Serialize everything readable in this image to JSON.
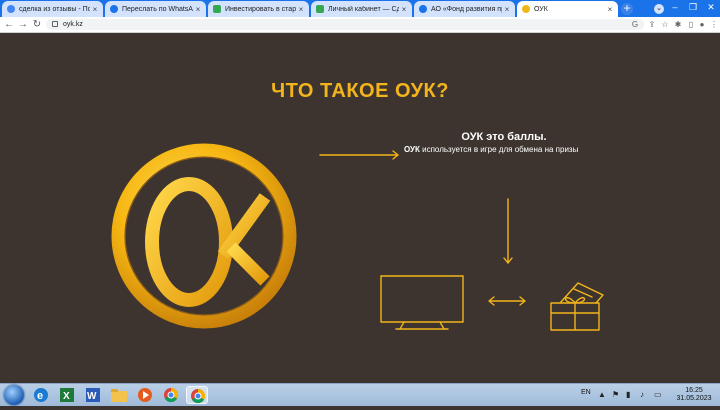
{
  "browser": {
    "tabs": [
      {
        "title": "сделка из отзывы - Поиск в G",
        "favicon_color": "#4285f4"
      },
      {
        "title": "Переслать по WhatsApp",
        "favicon_color": "#1a73e8"
      },
      {
        "title": "Инвестировать в стартап - Сд",
        "favicon_color": "#34a853"
      },
      {
        "title": "Личный кабинет — Сделка",
        "favicon_color": "#34a853"
      },
      {
        "title": "АО «Фонд развития предпри",
        "favicon_color": "#1a73e8"
      },
      {
        "title": "ОУК",
        "favicon_color": "#f3b51c"
      }
    ],
    "new_tab": "+",
    "url": "oyk.kz"
  },
  "page": {
    "title": "ЧТО ТАКОЕ ОУК?",
    "desc_title": "ОУК это баллы.",
    "desc_bold": "ОУК",
    "desc_rest": " используется в игре для обмена на призы",
    "logo_letters": "ОУК",
    "accent_color": "#f3b51c",
    "background_color": "#3d342f"
  },
  "taskbar": {
    "language": "EN",
    "time": "16:25",
    "date": "31.05.2023",
    "apps": [
      "ie-icon",
      "excel-icon",
      "word-icon",
      "folder-icon",
      "media-icon",
      "chrome-icon",
      "chrome-icon"
    ]
  }
}
